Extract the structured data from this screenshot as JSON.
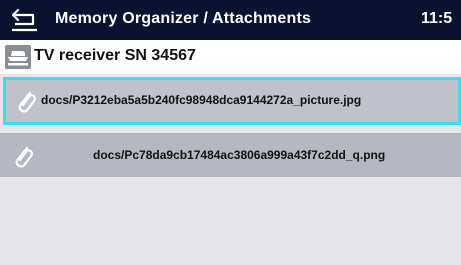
{
  "header": {
    "back_icon": "back-arrow-icon",
    "title": "Memory Organizer / Attachments",
    "time": "11:5",
    "background": "#0a1230"
  },
  "device": {
    "icon": "iron-device-icon",
    "title": "TV receiver SN 34567"
  },
  "attachments": [
    {
      "icon": "paperclip-icon",
      "path": "docs/P3212eba5a5b240fc98948dca9144272a_picture.jpg",
      "selected": true
    },
    {
      "icon": "paperclip-icon",
      "path": "docs/Pc78da9cb17484ac3806a999a43f7c2dd_q.png",
      "selected": false
    }
  ],
  "colors": {
    "selection_border": "#35e0f2",
    "item_background": "#b5b8c2",
    "list_background": "#e5e5e7"
  }
}
